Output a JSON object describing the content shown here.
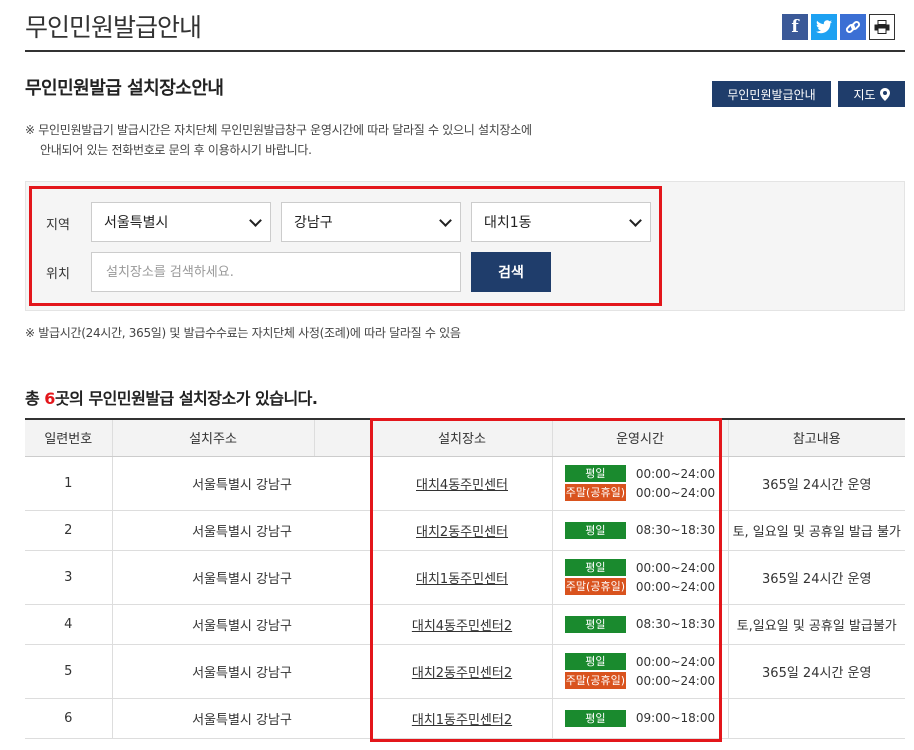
{
  "header": {
    "title": "무인민원발급안내"
  },
  "share": {
    "facebook": "f",
    "twitter": "t",
    "link": "∞",
    "print": "⎙"
  },
  "section": {
    "title": "무인민원발급 설치장소안내"
  },
  "nav": {
    "guide_label": "무인민원발급안내",
    "map_label": "지도"
  },
  "notice": {
    "line1": "※ 무인민원발급기 발급시간은 자치단체 무인민원발급창구 운영시간에 따라 달라질 수 있으니 설치장소에",
    "line2": "안내되어 있는 전화번호로 문의 후 이용하시기 바랍니다."
  },
  "search": {
    "region_label": "지역",
    "location_label": "위치",
    "sido": "서울특별시",
    "sigungu": "강남구",
    "dong": "대치1동",
    "placeholder": "설치장소를 검색하세요.",
    "button": "검색"
  },
  "notice2": "※ 발급시간(24시간, 365일) 및 발급수수료는 자치단체 사정(조례)에 따라 달라질 수 있음",
  "total": {
    "prefix": "총 ",
    "count": "6",
    "suffix": "곳의 무인민원발급 설치장소가 있습니다."
  },
  "table": {
    "headers": [
      "일련번호",
      "설치주소",
      "",
      "설치장소",
      "운영시간",
      "참고내용"
    ],
    "weekday_label": "평일",
    "weekend_label": "주말(공휴일)",
    "rows": [
      {
        "no": "1",
        "addr": "서울특별시 강남구",
        "place": "대치4동주민센터",
        "weekday": "00:00~24:00",
        "weekend": "00:00~24:00",
        "note": "365일 24시간 운영"
      },
      {
        "no": "2",
        "addr": "서울특별시 강남구",
        "place": "대치2동주민센터",
        "weekday": "08:30~18:30",
        "weekend": "",
        "note": "토, 일요일 및 공휴일 발급 불가"
      },
      {
        "no": "3",
        "addr": "서울특별시 강남구",
        "place": "대치1동주민센터",
        "weekday": "00:00~24:00",
        "weekend": "00:00~24:00",
        "note": "365일 24시간 운영"
      },
      {
        "no": "4",
        "addr": "서울특별시 강남구",
        "place": "대치4동주민센터2",
        "weekday": "08:30~18:30",
        "weekend": "",
        "note": "토,일요일 및 공휴일 발급불가"
      },
      {
        "no": "5",
        "addr": "서울특별시 강남구",
        "place": "대치2동주민센터2",
        "weekday": "00:00~24:00",
        "weekend": "00:00~24:00",
        "note": "365일 24시간 운영"
      },
      {
        "no": "6",
        "addr": "서울특별시 강남구",
        "place": "대치1동주민센터2",
        "weekday": "09:00~18:00",
        "weekend": "",
        "note": ""
      }
    ]
  },
  "colors": {
    "navy": "#1f3d6b",
    "highlight_red": "#e3161b",
    "weekday_green": "#1a8a2e",
    "weekend_orange": "#d9531e"
  }
}
